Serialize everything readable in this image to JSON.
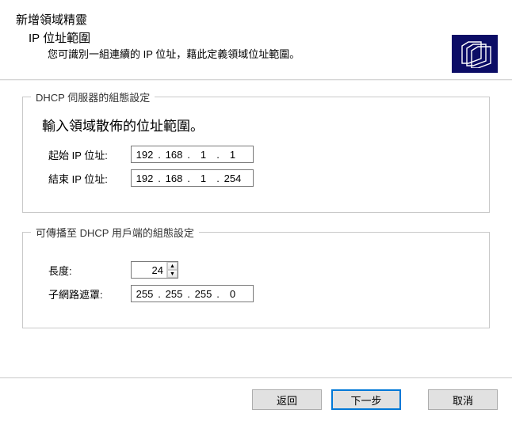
{
  "window_title": "新增領域精靈",
  "subtitle": "IP 位址範圍",
  "description": "您可識別一組連續的 IP 位址，藉此定義領域位址範圍。",
  "icon": "files-icon",
  "group1": {
    "legend": "DHCP 伺服器的組態設定",
    "instruction": "輸入領域散佈的位址範圍。",
    "start_label": "起始 IP 位址:",
    "end_label": "結束 IP 位址:",
    "start_ip": {
      "o1": "192",
      "o2": "168",
      "o3": "1",
      "o4": "1"
    },
    "end_ip": {
      "o1": "192",
      "o2": "168",
      "o3": "1",
      "o4": "254"
    }
  },
  "group2": {
    "legend": "可傳播至 DHCP 用戶端的組態設定",
    "length_label": "長度:",
    "length_value": "24",
    "mask_label": "子網路遮罩:",
    "mask": {
      "o1": "255",
      "o2": "255",
      "o3": "255",
      "o4": "0"
    }
  },
  "buttons": {
    "back": "返回",
    "next": "下一步",
    "cancel": "取消"
  }
}
